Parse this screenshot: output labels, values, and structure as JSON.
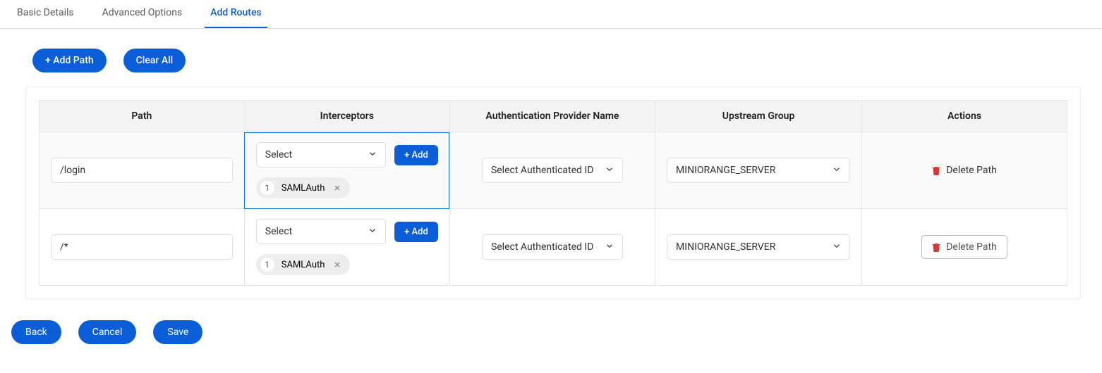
{
  "tabs": {
    "basic": "Basic Details",
    "advanced": "Advanced Options",
    "routes": "Add Routes"
  },
  "toolbar": {
    "add_path": "+ Add Path",
    "clear_all": "Clear All"
  },
  "columns": {
    "path": "Path",
    "interceptors": "Interceptors",
    "auth": "Authentication Provider Name",
    "upstream": "Upstream Group",
    "actions": "Actions"
  },
  "rows": [
    {
      "path": "/login",
      "interceptor_select": "Select",
      "add_label": "+ Add",
      "chip_index": "1",
      "chip_label": "SAMLAuth",
      "auth": "Select Authenticated ID",
      "upstream": "MINIORANGE_SERVER",
      "delete_label": "Delete Path"
    },
    {
      "path": "/*",
      "interceptor_select": "Select",
      "add_label": "+ Add",
      "chip_index": "1",
      "chip_label": "SAMLAuth",
      "auth": "Select Authenticated ID",
      "upstream": "MINIORANGE_SERVER",
      "delete_label": "Delete Path"
    }
  ],
  "footer": {
    "back": "Back",
    "cancel": "Cancel",
    "save": "Save"
  }
}
